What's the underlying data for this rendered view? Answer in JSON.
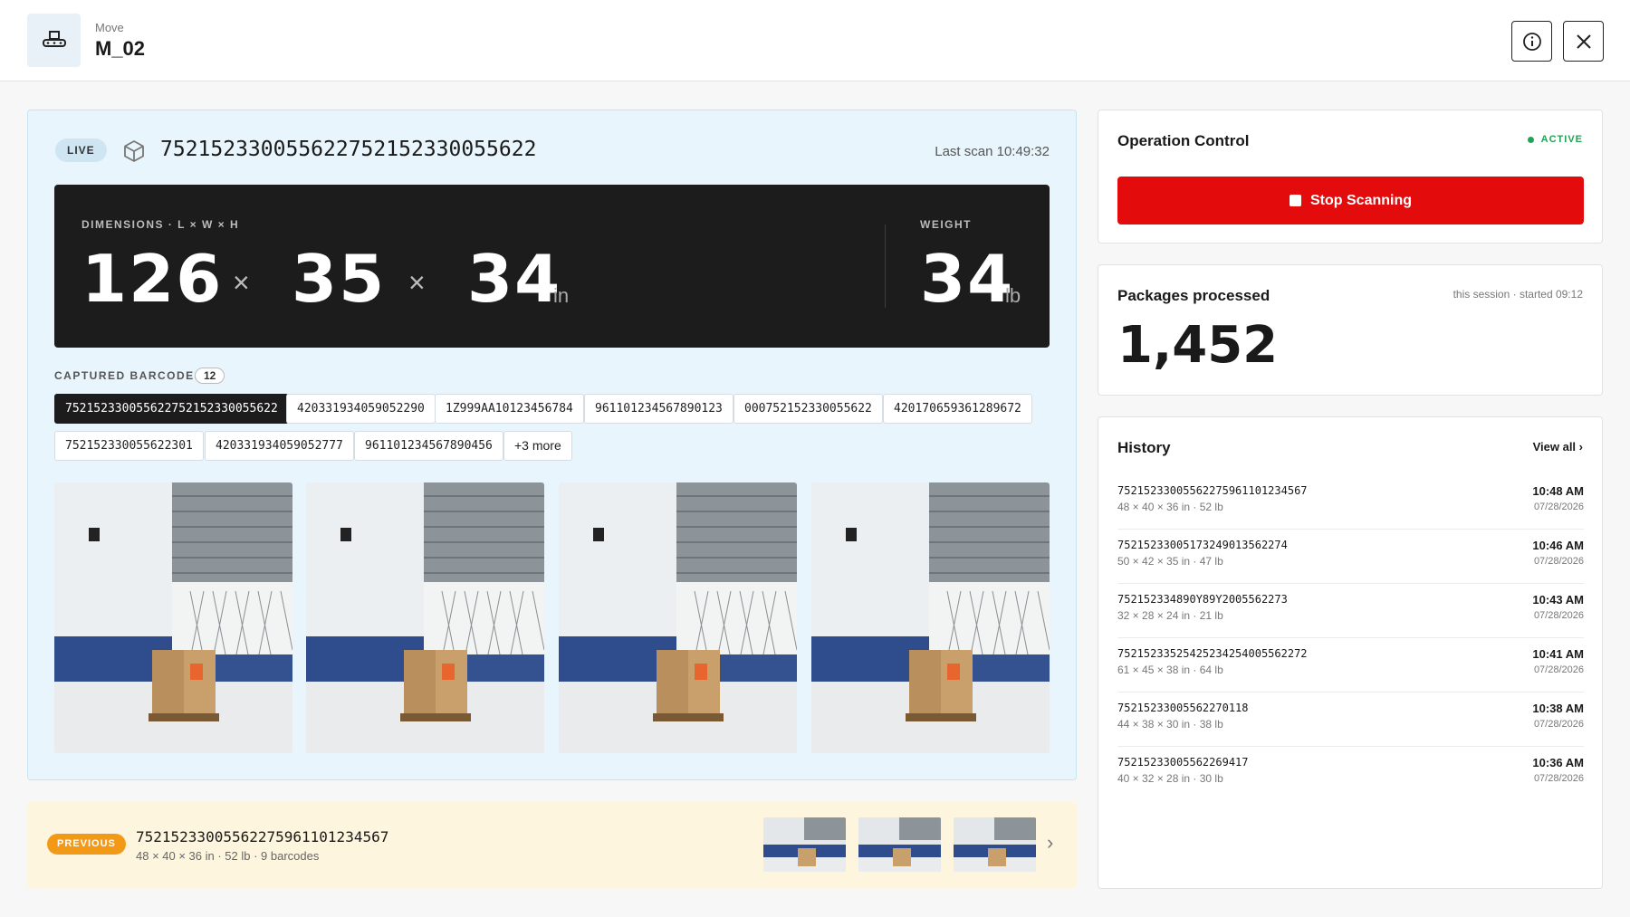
{
  "header": {
    "subtitle": "Move",
    "title": "M_02",
    "app_icon": "conveyor-icon",
    "info_icon": "info-icon",
    "close_icon": "close-icon"
  },
  "live": {
    "badge": "LIVE",
    "package_icon": "package-icon",
    "code": "75215233005562275215233005562​2",
    "last_scan": "Last scan 10:49:32",
    "dimensions_label": "DIMENSIONS · L × W × H",
    "length": "126",
    "width": "35",
    "height": "34",
    "times": "×",
    "dim_unit": "in",
    "weight_label": "WEIGHT",
    "weight": "34",
    "weight_unit": "lb"
  },
  "barcodes": {
    "label": "CAPTURED BARCODES",
    "count": "12",
    "items": [
      "752152330055622752152330055622",
      "420331934059052290",
      "1Z999AA10123456784",
      "961101234567890123",
      "0007521523300556​22",
      "420170659361289672",
      "752152330055622301",
      "420331934059052777",
      "961101234567890456"
    ],
    "more": "+3 more"
  },
  "previous": {
    "badge": "PREVIOUS",
    "code": "7521523300556227596110123456​7",
    "meta": "48 × 40 × 36 in  ·  52 lb  ·  9 barcodes",
    "chevron_icon": "chevron-right-icon"
  },
  "operation": {
    "title": "Operation Control",
    "status": "ACTIVE",
    "stop_label": "Stop Scanning"
  },
  "packages": {
    "title": "Packages processed",
    "session": "this session · started 09:12",
    "value": "1,452"
  },
  "history": {
    "title": "History",
    "view_all": "View all ›",
    "items": [
      {
        "code": "75215233005562275961101234567",
        "dims": "48 × 40 × 36 in · 52 lb",
        "time": "10:48 AM",
        "date": "07/28/2026"
      },
      {
        "code": "75215233005173249013562274",
        "dims": "50 × 42 × 35 in · 47 lb",
        "time": "10:46 AM",
        "date": "07/28/2026"
      },
      {
        "code": "752152334890Y89Y2005562273",
        "dims": "32 × 28 × 24 in · 21 lb",
        "time": "10:43 AM",
        "date": "07/28/2026"
      },
      {
        "code": "7521523352542523425400556227​2",
        "dims": "61 × 45 × 38 in · 64 lb",
        "time": "10:41 AM",
        "date": "07/28/2026"
      },
      {
        "code": "752152330055622701​18",
        "dims": "44 × 38 × 30 in · 38 lb",
        "time": "10:38 AM",
        "date": "07/28/2026"
      },
      {
        "code": "752152330055622694​17",
        "dims": "40 × 32 × 28 in · 30 lb",
        "time": "10:36 AM",
        "date": "07/28/2026"
      }
    ]
  }
}
